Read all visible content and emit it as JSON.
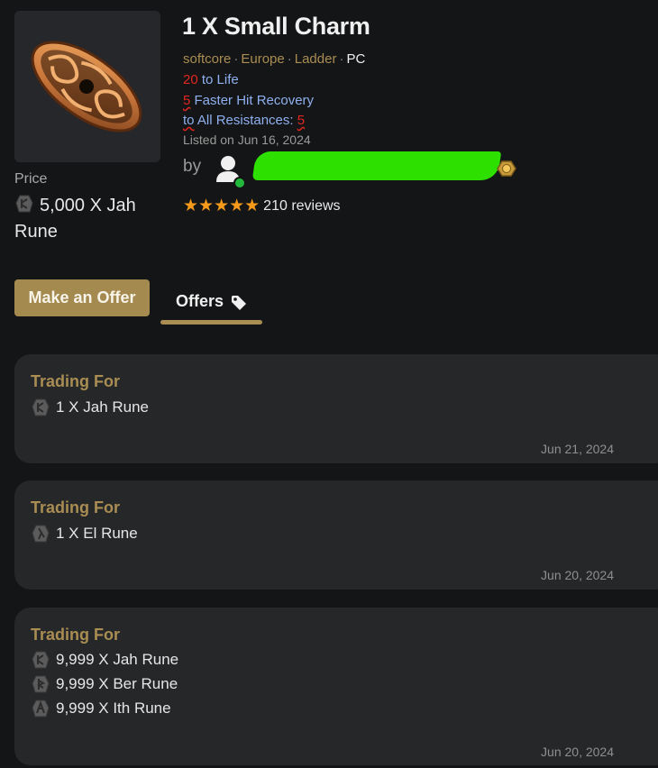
{
  "listing": {
    "title": "1 X Small Charm",
    "tags": [
      "softcore",
      "Europe",
      "Ladder"
    ],
    "platform": "PC",
    "stats": {
      "life_value": "20",
      "life_label": "to Life",
      "fhr_value": "5",
      "fhr_label": "Faster Hit Recovery",
      "res_label_a": "to",
      "res_label_b": " All Resistances: ",
      "res_value": "5"
    },
    "listed": "Listed on Jun 16, 2024",
    "by_label": "by",
    "stars": "★★★★★",
    "reviews": "210 reviews"
  },
  "price": {
    "label": "Price",
    "value": "5,000 X Jah Rune"
  },
  "actions": {
    "make_offer": "Make an Offer",
    "offers_tab": "Offers"
  },
  "offers": [
    {
      "heading": "Trading For",
      "items": [
        "1 X Jah Rune"
      ],
      "date": "Jun 21, 2024"
    },
    {
      "heading": "Trading For",
      "items": [
        "1 X El Rune"
      ],
      "date": "Jun 20, 2024"
    },
    {
      "heading": "Trading For",
      "items": [
        "9,999 X Jah Rune",
        "9,999 X Ber Rune",
        "9,999 X Ith Rune"
      ],
      "date": "Jun 20, 2024"
    }
  ],
  "colors": {
    "accent": "#a98d52",
    "button": "#a48a4f",
    "stat_blue": "#8fb0f0",
    "stat_red": "#e0261f",
    "star": "#f59a1a",
    "online": "#22b83a"
  },
  "icons": [
    "rune-icon",
    "tag-icon",
    "user-icon",
    "seller-badge-icon",
    "star-icon"
  ]
}
